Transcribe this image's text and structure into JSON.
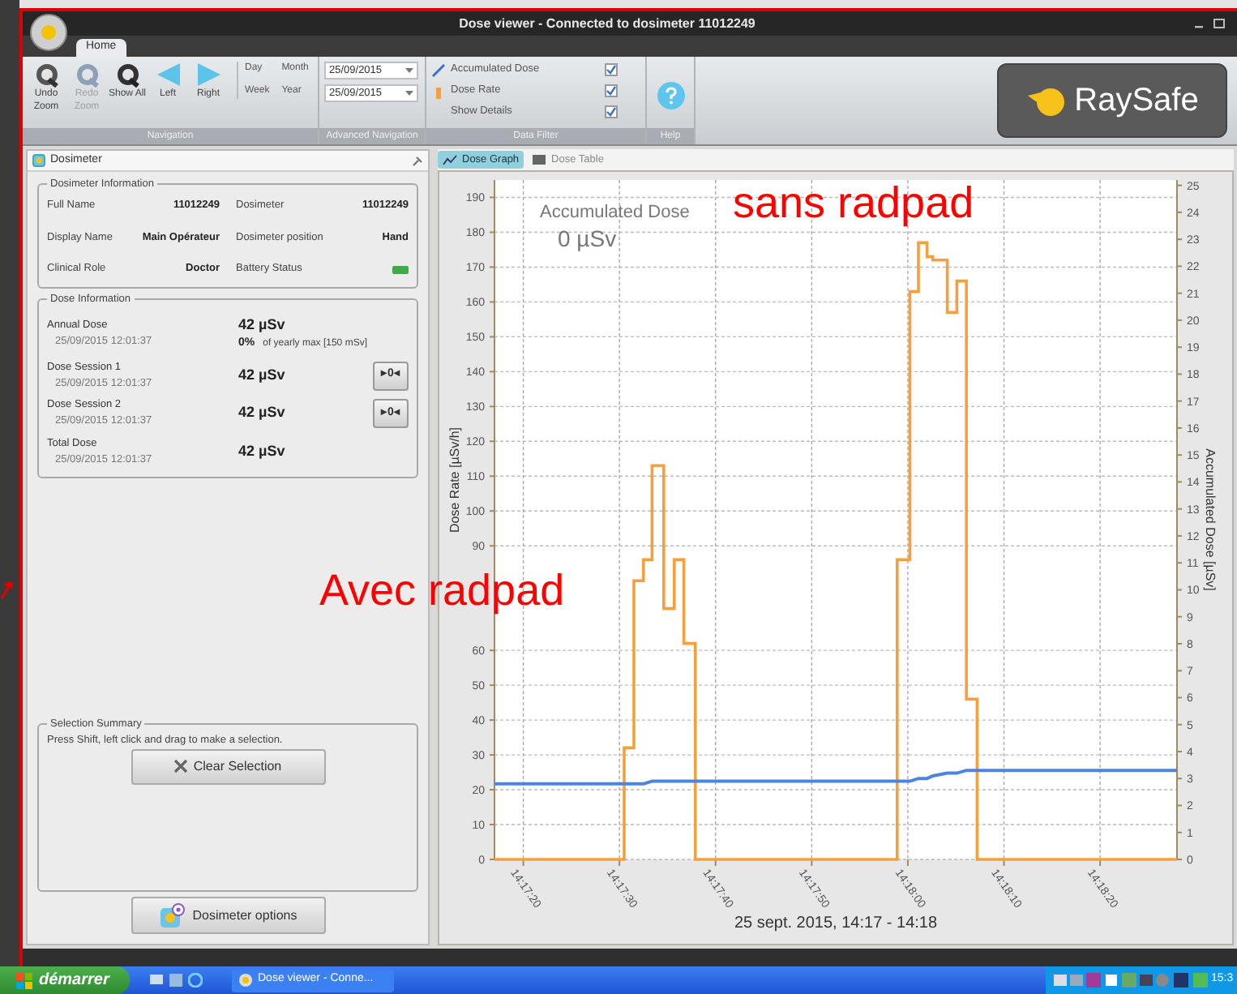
{
  "window": {
    "title": "Dose viewer - Connected to dosimeter 11012249"
  },
  "ribbon_tabs": [
    {
      "label": "Home",
      "selected": true
    }
  ],
  "navigation": {
    "group_label": "Navigation",
    "buttons": [
      {
        "label": "Undo Zoom",
        "kind": "undo",
        "disabled": false
      },
      {
        "label": "Redo Zoom",
        "kind": "redo",
        "disabled": true
      },
      {
        "label": "Show All",
        "kind": "all",
        "disabled": false
      },
      {
        "label": "Left",
        "kind": "left",
        "disabled": false
      },
      {
        "label": "Right",
        "kind": "right",
        "disabled": false
      }
    ],
    "periods": [
      "Day",
      "Month",
      "Week",
      "Year"
    ]
  },
  "advanced_navigation": {
    "group_label": "Advanced Navigation",
    "from": "25/09/2015",
    "to": "25/09/2015"
  },
  "data_filter": {
    "group_label": "Data Filter",
    "items": [
      {
        "label": "Accumulated Dose",
        "kind": "line",
        "checked": true
      },
      {
        "label": "Dose Rate",
        "kind": "rate",
        "checked": true
      },
      {
        "label": "Show Details",
        "kind": "plain",
        "checked": true
      }
    ]
  },
  "help": {
    "group_label": "Help"
  },
  "logo": {
    "text": "RaySafe"
  },
  "dosimeter_panel": {
    "title": "Dosimeter",
    "info": {
      "title": "Dosimeter Information",
      "fields": [
        {
          "label": "Full Name",
          "value": "11012249"
        },
        {
          "label": "Dosimeter",
          "value": "11012249"
        },
        {
          "label": "Display Name",
          "value": "Main Opérateur"
        },
        {
          "label": "Dosimeter position",
          "value": "Hand"
        },
        {
          "label": "Clinical Role",
          "value": "Doctor"
        },
        {
          "label": "Battery Status",
          "kind": "battery"
        }
      ]
    },
    "dose_info": {
      "title": "Dose Information",
      "rows": [
        {
          "label": "Annual Dose",
          "time": "25/09/2015 12:01:37",
          "value": "42 µSv",
          "percent": "0%",
          "percent_note": "of yearly max [150 mSv]"
        },
        {
          "label": "Dose Session 1",
          "time": "25/09/2015 12:01:37",
          "value": "42 µSv",
          "reset": "▸0◂"
        },
        {
          "label": "Dose Session 2",
          "time": "25/09/2015 12:01:37",
          "value": "42 µSv",
          "reset": "▸0◂"
        },
        {
          "label": "Total Dose",
          "time": "25/09/2015 12:01:37",
          "value": "42 µSv"
        }
      ]
    },
    "selection_summary": {
      "title": "Selection Summary",
      "text": "Press Shift, left click and drag to make a selection.",
      "clear_button": "Clear Selection"
    },
    "options_button": "Dosimeter options"
  },
  "view_tabs": [
    {
      "label": "Dose Graph",
      "kind": "graph",
      "selected": true
    },
    {
      "label": "Dose Table",
      "kind": "table",
      "selected": false
    }
  ],
  "graph": {
    "overlay_title": "Accumulated Dose",
    "overlay_value": "0 µSv",
    "chart_data": {
      "type": "line",
      "grid": true,
      "xlabel": "25 sept. 2015, 14:17 - 14:18",
      "ylabel": "Dose Rate [µSv/h]",
      "y2label": "Accumulated Dose [µSv]",
      "xlim": [
        51437,
        51508
      ],
      "ylim": [
        0,
        195
      ],
      "y2lim": [
        0,
        25.2
      ],
      "xticks": [
        {
          "value": 51440,
          "label": "14:17:20"
        },
        {
          "value": 51450,
          "label": "14:17:30"
        },
        {
          "value": 51460,
          "label": "14:17:40"
        },
        {
          "value": 51470,
          "label": "14:17:50"
        },
        {
          "value": 51480,
          "label": "14:18:00"
        },
        {
          "value": 51490,
          "label": "14:18:10"
        },
        {
          "value": 51500,
          "label": "14:18:20"
        }
      ],
      "yticks": [
        0,
        10,
        20,
        30,
        40,
        50,
        60,
        90,
        100,
        110,
        120,
        130,
        140,
        150,
        160,
        170,
        180,
        190
      ],
      "y2ticks": [
        0,
        1,
        2,
        3,
        4,
        5,
        6,
        7,
        8,
        9,
        10,
        11,
        12,
        13,
        14,
        15,
        16,
        17,
        18,
        19,
        20,
        21,
        22,
        23,
        24,
        25
      ],
      "x": [
        51437,
        51450.5,
        51450.5,
        51451.5,
        51451.5,
        51452.5,
        51452.5,
        51453.4,
        51453.4,
        51454.6,
        51454.6,
        51455.7,
        51455.7,
        51456.7,
        51456.7,
        51457.9,
        51457.9,
        51478.9,
        51478.9,
        51480.2,
        51480.2,
        51481.1,
        51481.1,
        51482.0,
        51482.0,
        51482.6,
        51482.6,
        51484.1,
        51484.1,
        51485.1,
        51485.1,
        51486.1,
        51486.1,
        51487.2,
        51487.2,
        51508
      ],
      "series": [
        {
          "color": "#f5a03c",
          "values": [
            0,
            0,
            32,
            32,
            80,
            80,
            86,
            86,
            113,
            113,
            72,
            72,
            86,
            86,
            62,
            62,
            0,
            0,
            86,
            86,
            163,
            163,
            177,
            177,
            173,
            173,
            172,
            172,
            157,
            157,
            166,
            166,
            46,
            46,
            0,
            0
          ]
        },
        {
          "color": "#4a86e0",
          "axis": "y2",
          "values": [
            2.8,
            2.8,
            2.8,
            2.8,
            2.8,
            2.8,
            2.8,
            2.9,
            2.9,
            2.9,
            2.9,
            2.9,
            2.9,
            2.9,
            2.9,
            2.9,
            2.9,
            2.9,
            2.9,
            2.9,
            2.9,
            3.0,
            3.0,
            3.0,
            3.0,
            3.1,
            3.1,
            3.2,
            3.2,
            3.2,
            3.2,
            3.3,
            3.3,
            3.3,
            3.3,
            3.3
          ]
        }
      ]
    }
  },
  "annotations": [
    {
      "text": "sans radpad",
      "kind": "top"
    },
    {
      "text": "Avec radpad",
      "kind": "middle"
    }
  ],
  "taskbar": {
    "start": "démarrer",
    "tasks": [
      {
        "label": "Dose viewer - Conne...",
        "selected": false
      }
    ],
    "clock": "15:3"
  }
}
